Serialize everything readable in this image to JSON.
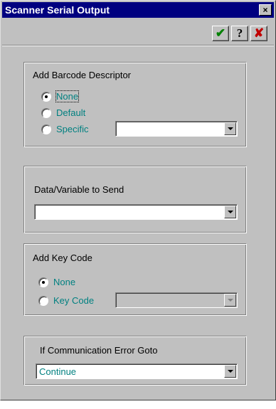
{
  "window": {
    "title": "Scanner Serial Output",
    "close_glyph": "×"
  },
  "toolbar": {
    "ok_icon": "✔",
    "help_icon": "?",
    "cancel_icon": "✘"
  },
  "barcode_descriptor": {
    "label": "Add Barcode Descriptor",
    "options": [
      "None",
      "Default",
      "Specific"
    ],
    "selected": "None",
    "specific_value": ""
  },
  "data_variable": {
    "label": "Data/Variable to Send",
    "value": ""
  },
  "key_code": {
    "label": "Add Key Code",
    "options": [
      "None",
      "Key Code"
    ],
    "selected": "None",
    "value": ""
  },
  "comm_error": {
    "label": "If Communication Error Goto",
    "value": "Continue"
  }
}
